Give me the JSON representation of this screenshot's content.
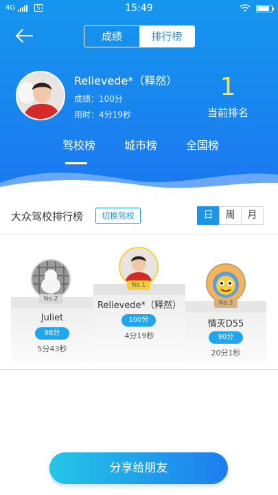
{
  "status_bar": {
    "network": "4G",
    "time": "15:49",
    "sim": "S"
  },
  "nav": {
    "tabs": [
      "成绩",
      "排行榜"
    ],
    "active_tab": 1
  },
  "profile": {
    "name": "Relievede*（释然）",
    "score": "成绩：100分",
    "time_used": "用时：4分19秒",
    "rank": "1",
    "rank_label": "当前排名"
  },
  "scope_tabs": {
    "items": [
      "驾校榜",
      "城市榜",
      "全国榜"
    ],
    "active": 0
  },
  "board": {
    "title": "大众驾校排行榜",
    "switch_label": "切换驾校",
    "periods": [
      "日",
      "周",
      "月"
    ],
    "active_period": 0
  },
  "podium": {
    "second": {
      "tag": "No.2",
      "name": "Juliet",
      "score": "98分",
      "time": "5分43秒"
    },
    "first": {
      "tag": "No.1",
      "name": "Relievede*（释然）",
      "score": "100分",
      "time": "4分19秒"
    },
    "third": {
      "tag": "No.3",
      "name": "情灭D55",
      "score": "90分",
      "time": "20分1秒"
    }
  },
  "share_button": "分享给朋友",
  "colors": {
    "header_blue": "#1b82f0",
    "accent_blue": "#1a95e8",
    "rank_yellow": "#ffe34d",
    "gold_tag": "#f5cf3a"
  }
}
